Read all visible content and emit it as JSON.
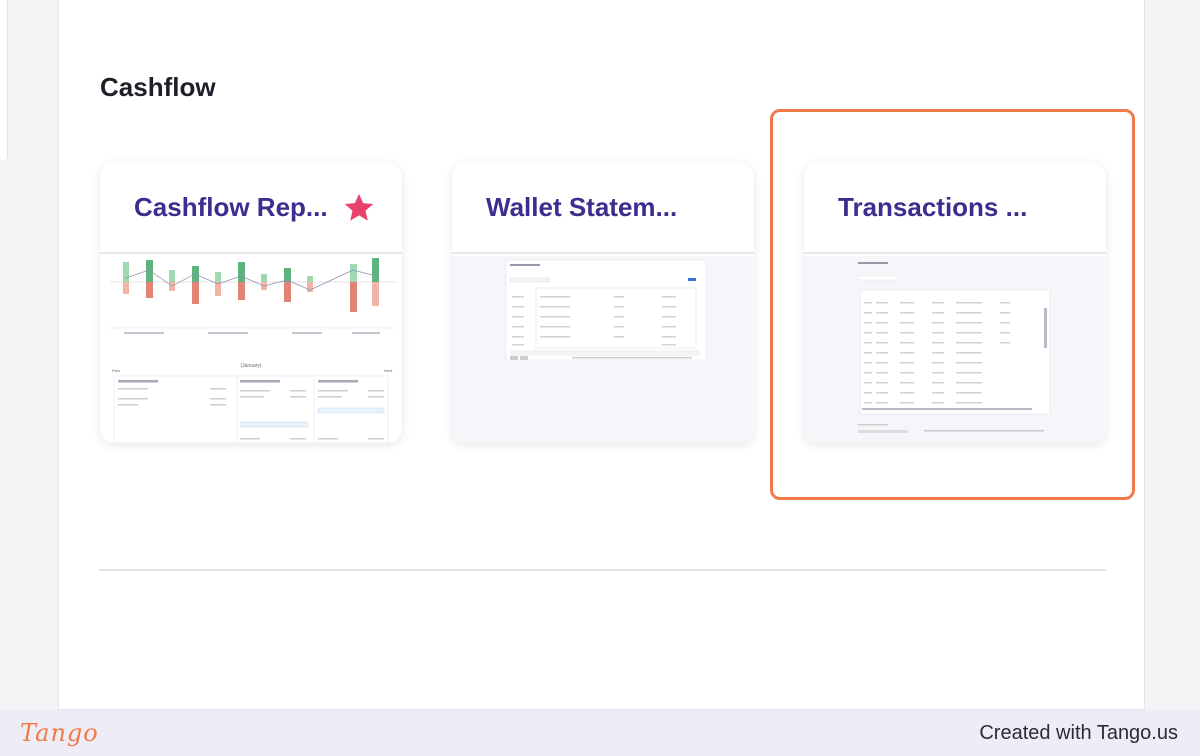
{
  "section": {
    "title": "Cashflow"
  },
  "cards": [
    {
      "title": "Cashflow Rep...",
      "favorite": true,
      "accent": "#e8436a"
    },
    {
      "title": "Wallet Statem..."
    },
    {
      "title": "Transactions ..."
    }
  ],
  "thumb_cashflow": {
    "month": "(January)",
    "prev": "Prev",
    "next": "Next"
  },
  "footer": {
    "logo": "Tango",
    "credit": "Created with Tango.us"
  },
  "colors": {
    "accent": "#f07a4a",
    "title": "#3b2e8f"
  }
}
